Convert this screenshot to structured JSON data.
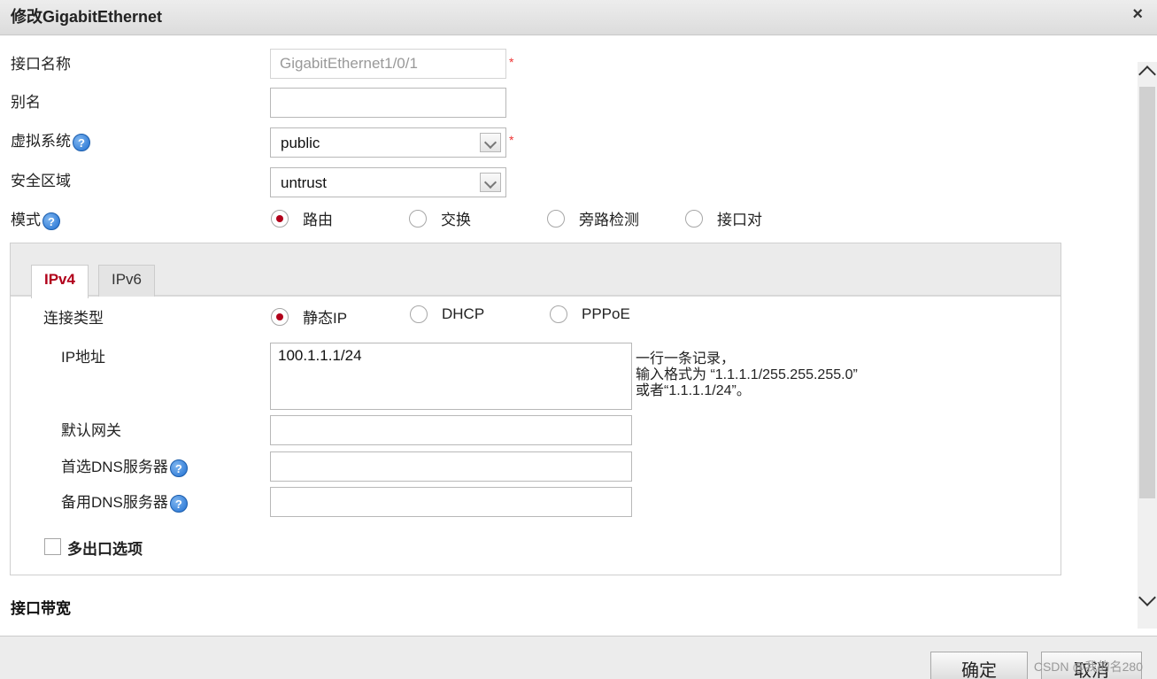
{
  "dialog": {
    "title": "修改GigabitEthernet",
    "close_glyph": "×"
  },
  "form": {
    "interface_name_label": "接口名称",
    "interface_name_value": "GigabitEthernet1/0/1",
    "alias_label": "别名",
    "alias_value": "",
    "vsys_label": "虚拟系统",
    "vsys_value": "public",
    "zone_label": "安全区域",
    "zone_value": "untrust",
    "mode_label": "模式",
    "modes": [
      "路由",
      "交换",
      "旁路检测",
      "接口对"
    ],
    "mode_selected": "路由",
    "required_mark": "*",
    "help_glyph": "?"
  },
  "tabs": [
    {
      "label": "IPv4",
      "active": true
    },
    {
      "label": "IPv6",
      "active": false
    }
  ],
  "ipv4": {
    "conn_type_label": "连接类型",
    "conn_types": [
      "静态IP",
      "DHCP",
      "PPPoE"
    ],
    "conn_type_selected": "静态IP",
    "ip_label": "IP地址",
    "ip_value": "100.1.1.1/24",
    "hint_lines": [
      "一行一条记录，",
      "输入格式为 “1.1.1.1/255.255.255.0”",
      "或者“1.1.1.1/24”。"
    ],
    "gateway_label": "默认网关",
    "gateway_value": "",
    "dns1_label": "首选DNS服务器",
    "dns1_value": "",
    "dns2_label": "备用DNS服务器",
    "dns2_value": "",
    "multi_egress_label": "多出口选项",
    "multi_egress_checked": false
  },
  "sections": {
    "bandwidth_label": "接口带宽"
  },
  "footer": {
    "ok_label": "确定",
    "cancel_label": "取消",
    "watermark": "CSDN @我的名280"
  },
  "colors": {
    "accent": "#b1001a",
    "required": "#e33333",
    "help": "#1f6fd1"
  }
}
